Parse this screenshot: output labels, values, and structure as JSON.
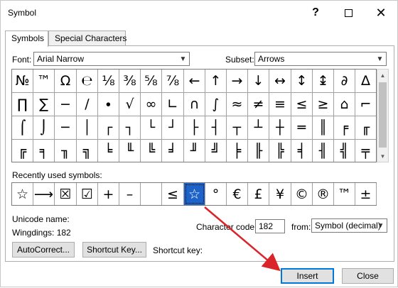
{
  "window": {
    "title": "Symbol"
  },
  "tabs": [
    {
      "label": "Symbols",
      "active": true
    },
    {
      "label": "Special Characters",
      "active": false
    }
  ],
  "font": {
    "label": "Font:",
    "value": "Arial Narrow"
  },
  "subset": {
    "label": "Subset:",
    "value": "Arrows"
  },
  "symbol_grid": [
    [
      "№",
      "™",
      "Ω",
      "℮",
      "⅛",
      "⅜",
      "⅝",
      "⅞",
      "←",
      "↑",
      "→",
      "↓",
      "↔",
      "↕",
      "↨",
      "∂",
      "∆"
    ],
    [
      "∏",
      "∑",
      "−",
      "∕",
      "∙",
      "√",
      "∞",
      "∟",
      "∩",
      "∫",
      "≈",
      "≠",
      "≡",
      "≤",
      "≥",
      "⌂",
      "⌐"
    ],
    [
      "⌠",
      "⌡",
      "─",
      "│",
      "┌",
      "┐",
      "└",
      "┘",
      "├",
      "┤",
      "┬",
      "┴",
      "┼",
      "═",
      "║",
      "╒",
      "╓"
    ],
    [
      "╔",
      "╕",
      "╖",
      "╗",
      "╘",
      "╙",
      "╚",
      "╛",
      "╜",
      "╝",
      "╞",
      "╟",
      "╠",
      "╡",
      "╢",
      "╣",
      "╤"
    ]
  ],
  "recent": {
    "label": "Recently used symbols:",
    "symbols": [
      "☆",
      "⟶",
      "☒",
      "☑",
      "+",
      "–",
      " ",
      "≤",
      "☆",
      "°",
      "€",
      "£",
      "¥",
      "©",
      "®",
      "™",
      "±"
    ],
    "selected_index": 8
  },
  "unicode": {
    "label": "Unicode name:",
    "name": "Wingdings: 182"
  },
  "char_code": {
    "label": "Character code:",
    "value": "182"
  },
  "from": {
    "label": "from:",
    "value": "Symbol (decimal)"
  },
  "buttons": {
    "autocorrect": "AutoCorrect...",
    "shortcut_key_btn": "Shortcut Key...",
    "shortcut_key_label": "Shortcut key:",
    "insert": "Insert",
    "close": "Close"
  },
  "colors": {
    "selection": "#1e64c8",
    "annotation_arrow": "#d9252a"
  }
}
